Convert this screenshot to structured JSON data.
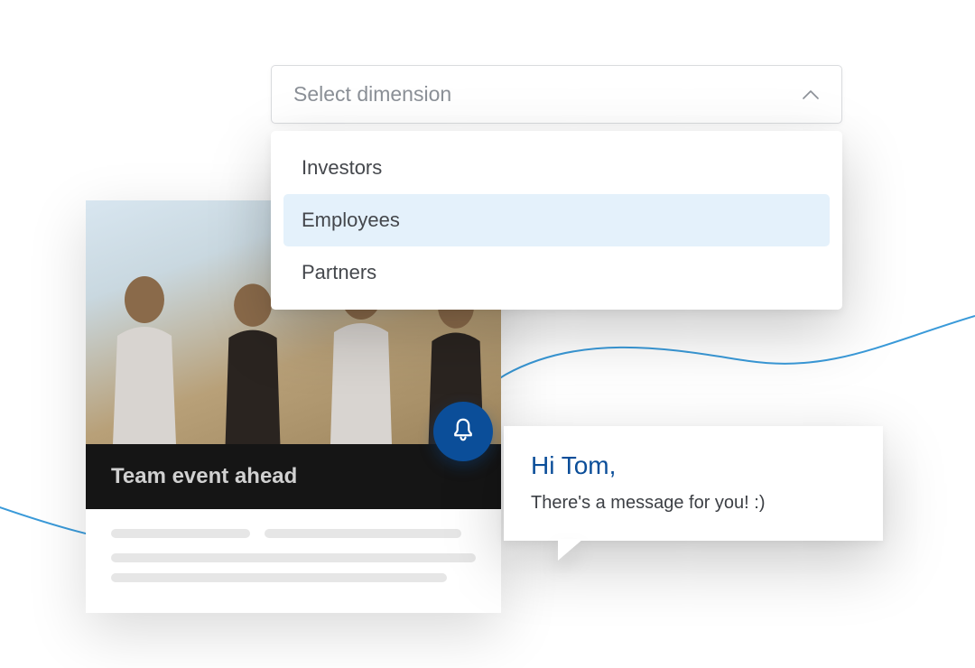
{
  "dropdown": {
    "placeholder": "Select dimension",
    "options": [
      {
        "label": "Investors",
        "highlighted": false
      },
      {
        "label": "Employees",
        "highlighted": true
      },
      {
        "label": "Partners",
        "highlighted": false
      }
    ]
  },
  "event_card": {
    "title": "Team event ahead"
  },
  "notification": {
    "icon": "bell-icon"
  },
  "message": {
    "greeting": "Hi Tom,",
    "body": "There's a message for you! :)"
  },
  "colors": {
    "brand_blue": "#0b4e99",
    "highlight_blue": "#e4f1fb",
    "wave_blue": "#3a9ad9"
  }
}
